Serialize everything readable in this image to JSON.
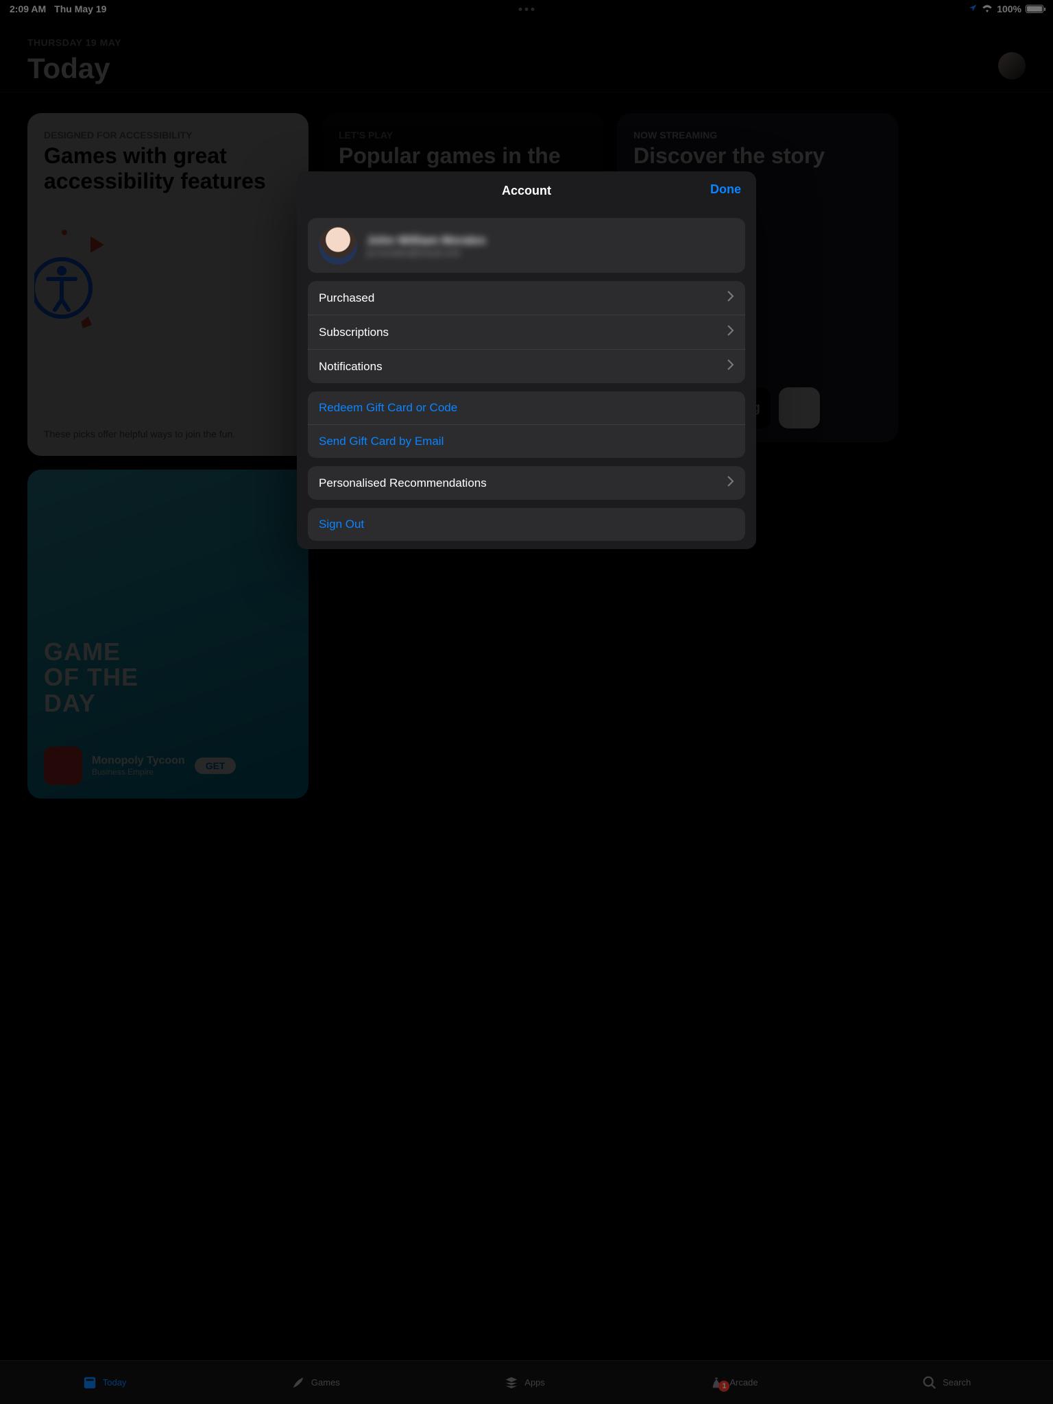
{
  "status": {
    "time": "2:09 AM",
    "date": "Thu May 19",
    "battery_pct": "100%"
  },
  "page": {
    "date_label": "THURSDAY 19 MAY",
    "title": "Today"
  },
  "card1": {
    "tag": "DESIGNED FOR ACCESSIBILITY",
    "headline": "Games with great accessibility features",
    "footer": "These picks offer helpful ways to join the fun."
  },
  "card2": {
    "tag": "LET'S PLAY",
    "headline": "Popular games in the region"
  },
  "card3": {
    "tag": "NOW STREAMING",
    "headline": "Discover the story behind"
  },
  "card4": {
    "big_line": "GAME\nOF THE\nDAY",
    "promo_title": "Monopoly Tycoon",
    "promo_sub": "Business Empire",
    "get": "GET"
  },
  "tabs": {
    "today": "Today",
    "games": "Games",
    "apps": "Apps",
    "arcade": "Arcade",
    "search": "Search",
    "arcade_badge": "1"
  },
  "sheet": {
    "title": "Account",
    "done": "Done",
    "profile_name": "John William Morales",
    "profile_mail": "jw.morales@icloud.com",
    "purchased": "Purchased",
    "subscriptions": "Subscriptions",
    "notifications": "Notifications",
    "redeem": "Redeem Gift Card or Code",
    "send_gift": "Send Gift Card by Email",
    "personalised": "Personalised Recommendations",
    "signout": "Sign Out"
  }
}
